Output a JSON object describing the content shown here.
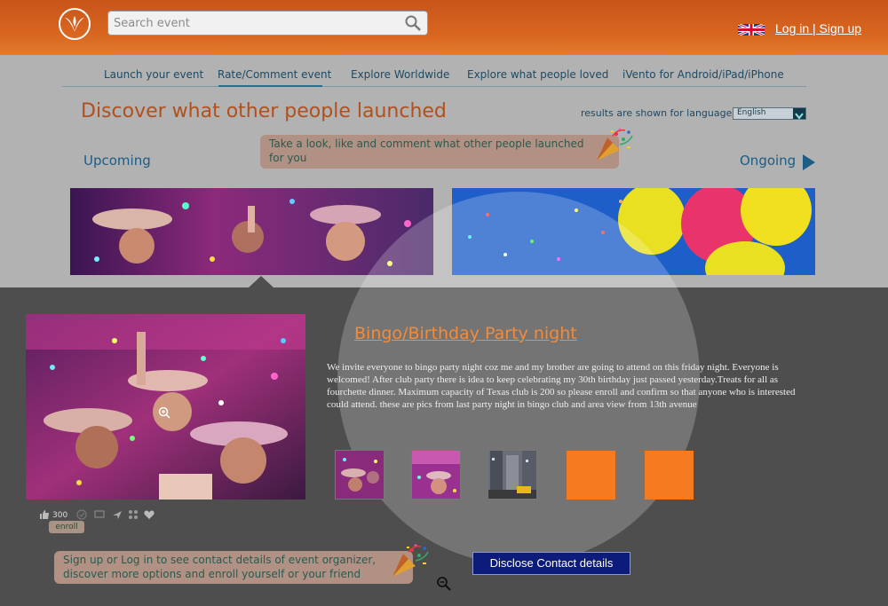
{
  "header": {
    "search_placeholder": "Search event",
    "login_signup": "Log in | Sign up",
    "language_flag_icon": "uk-flag-icon",
    "logo_icon": "ivento-logo-icon"
  },
  "nav": {
    "items": [
      {
        "label": "Launch your event"
      },
      {
        "label": "Rate/Comment event"
      },
      {
        "label": "Explore Worldwide"
      },
      {
        "label": "Explore what people loved"
      },
      {
        "label": "iVento for Android/iPad/iPhone"
      }
    ],
    "active": "Rate/Comment event"
  },
  "discover": {
    "headline": "Discover what other people launched",
    "language_label": "results are shown for language",
    "language_value": "English",
    "tip_line1": "Take a look, like and comment what other people launched",
    "tip_line2": "for you",
    "upcoming": "Upcoming",
    "ongoing": "Ongoing"
  },
  "event": {
    "title": "Bingo/Birthday Party night",
    "description": "We invite everyone to bingo party night coz me and my brother are going to attend on this friday night. Everyone is welcomed! After club party there is idea to keep celebrating my 30th birthday just passed yesterday.Treats for all as fourchette dinner. Maximum capacity of Texas club is 200 so please enroll and confirm so that anyone who is interested could attend. these are pics from last party night in bingo club and area view from 13th avenue",
    "like_count": "300",
    "enroll_label": "enroll",
    "disclose_label": "Disclose Contact details",
    "signup_line1": "Sign up or Log in to see contact details of event organizer,",
    "signup_line2": "discover more options and enroll yourself or your friend"
  },
  "colors": {
    "header_orange": "#d8651f",
    "title_orange": "#f08c3c",
    "nav_blue": "#1c4a63",
    "button_navy": "#0d1b7a",
    "placeholder_orange": "#f57a20"
  }
}
